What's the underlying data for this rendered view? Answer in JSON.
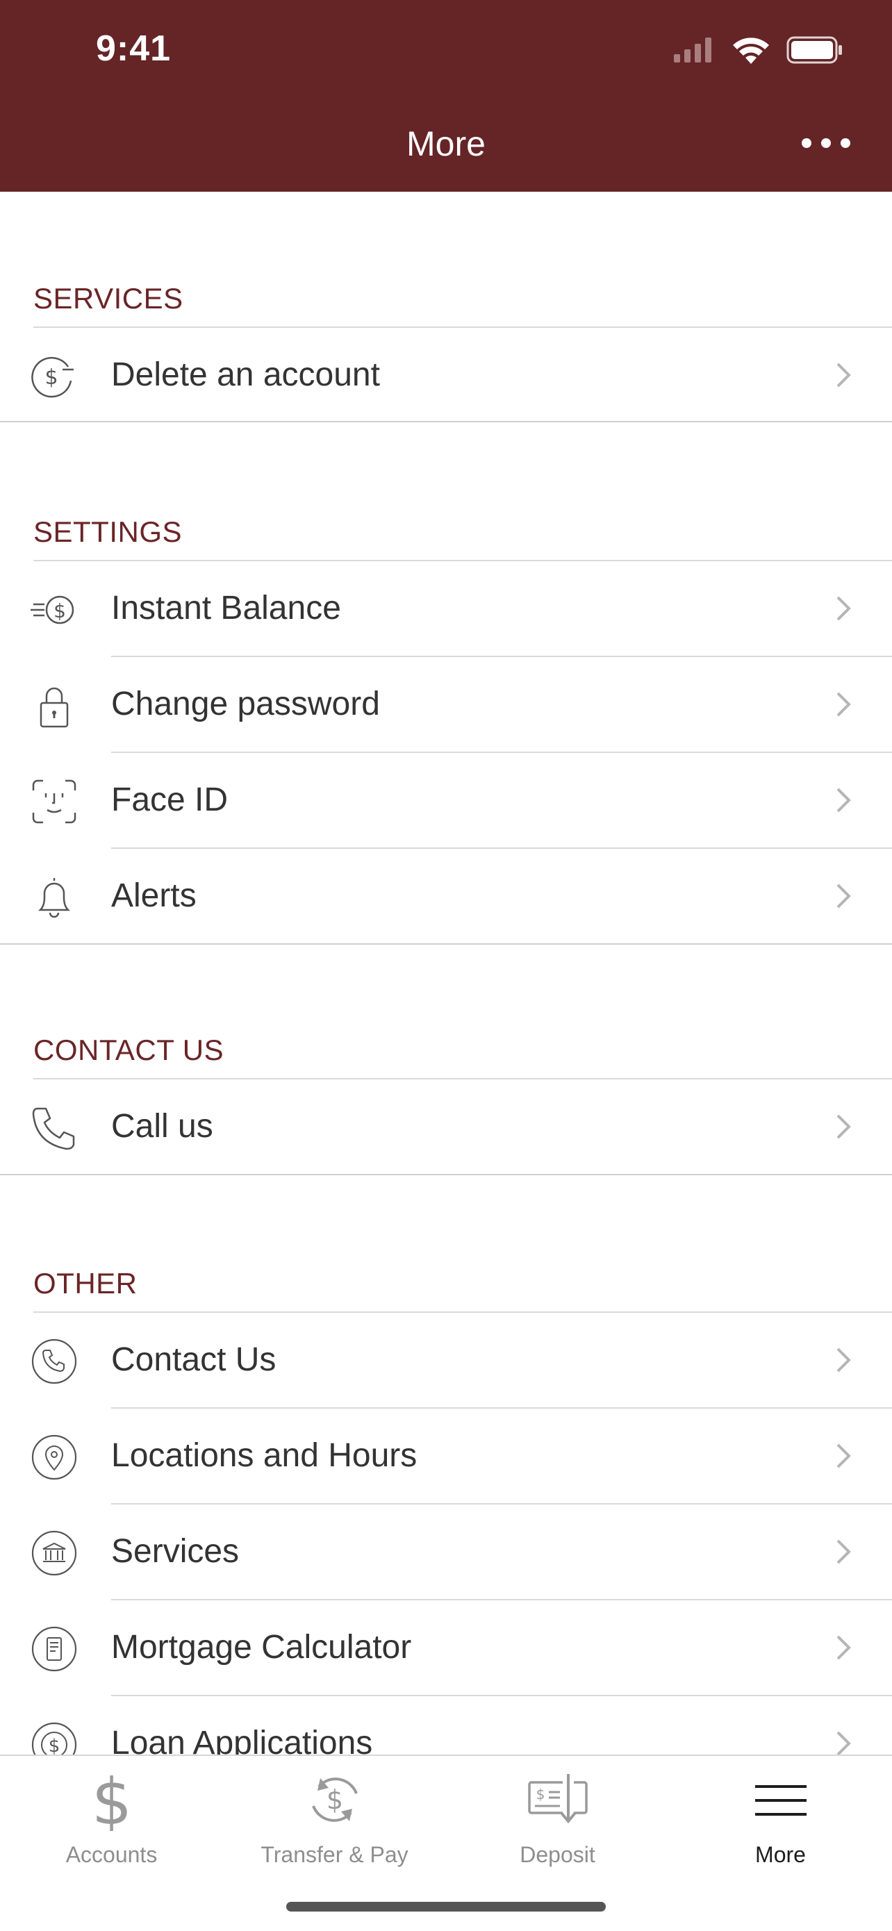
{
  "status_bar": {
    "time": "9:41"
  },
  "header": {
    "title": "More"
  },
  "sections": [
    {
      "title": "SERVICES",
      "items": [
        {
          "label": "Delete an account",
          "icon": "dollar-minus-icon"
        }
      ]
    },
    {
      "title": "SETTINGS",
      "items": [
        {
          "label": "Instant Balance",
          "icon": "instant-balance-icon"
        },
        {
          "label": "Change password",
          "icon": "lock-icon"
        },
        {
          "label": "Face ID",
          "icon": "face-id-icon"
        },
        {
          "label": "Alerts",
          "icon": "bell-icon"
        }
      ]
    },
    {
      "title": "CONTACT US",
      "items": [
        {
          "label": "Call us",
          "icon": "phone-icon"
        }
      ]
    },
    {
      "title": "OTHER",
      "items": [
        {
          "label": "Contact Us",
          "icon": "phone-circle-icon"
        },
        {
          "label": "Locations and Hours",
          "icon": "location-pin-icon"
        },
        {
          "label": "Services",
          "icon": "bank-icon"
        },
        {
          "label": "Mortgage Calculator",
          "icon": "calculator-icon"
        },
        {
          "label": "Loan Applications",
          "icon": "dollar-circle-icon"
        }
      ]
    }
  ],
  "tabs": [
    {
      "label": "Accounts",
      "icon": "dollar-icon"
    },
    {
      "label": "Transfer & Pay",
      "icon": "transfer-icon"
    },
    {
      "label": "Deposit",
      "icon": "deposit-check-icon"
    },
    {
      "label": "More",
      "icon": "menu-icon",
      "active": true
    }
  ],
  "colors": {
    "brand": "#652426",
    "section_title": "#6a2527"
  }
}
